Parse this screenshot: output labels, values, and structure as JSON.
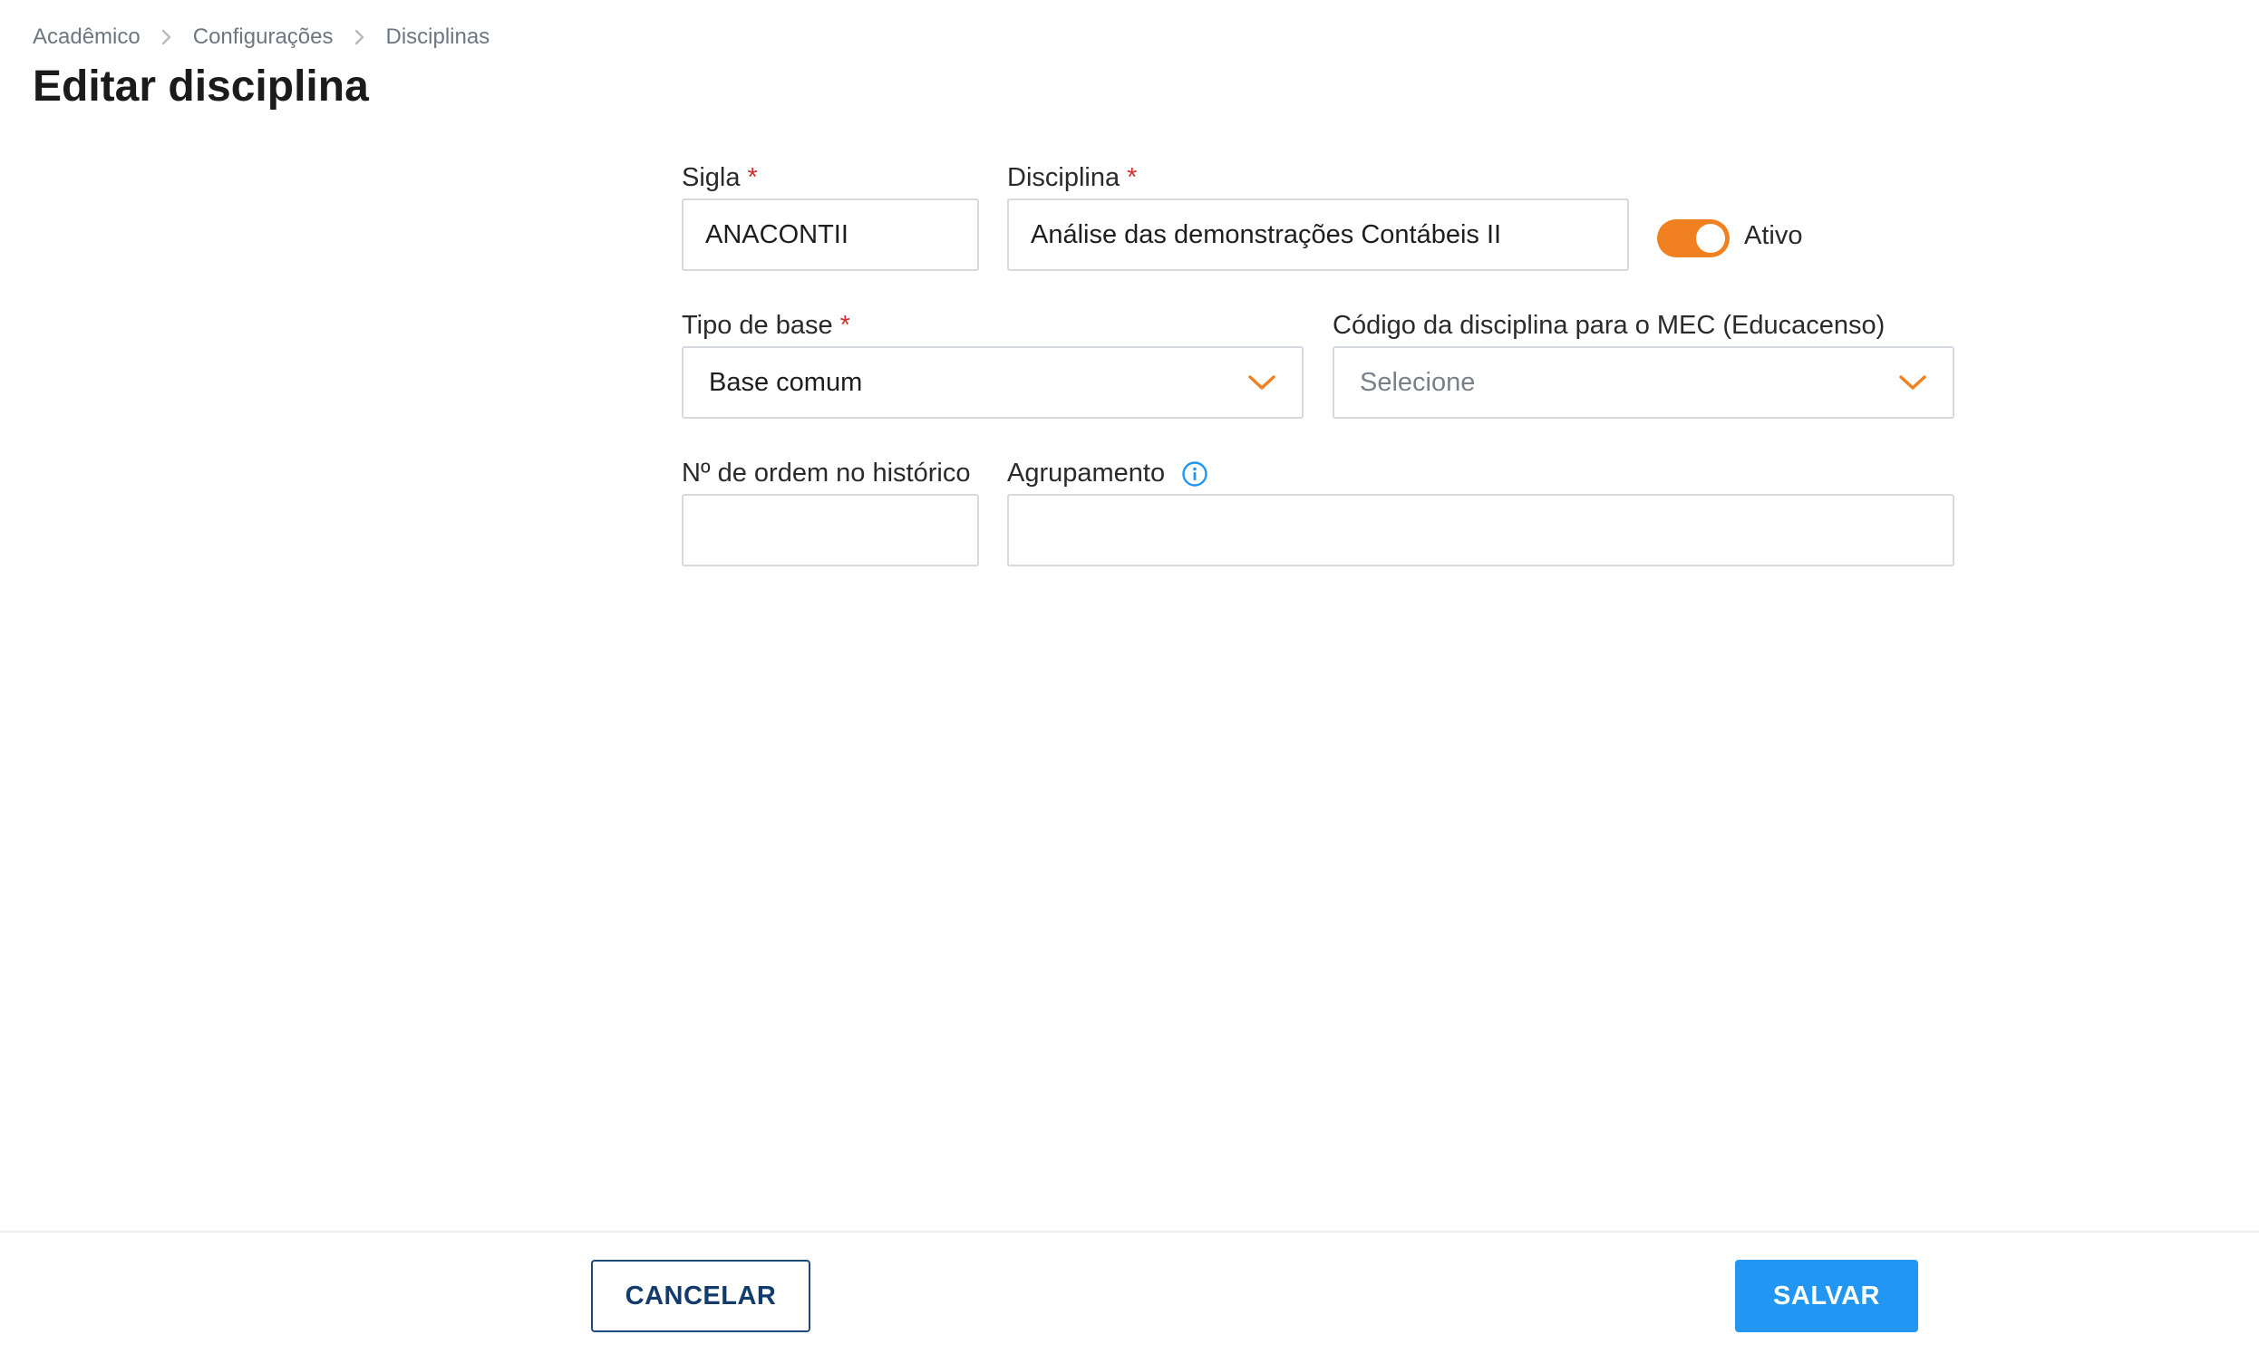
{
  "breadcrumb": {
    "items": [
      "Acadêmico",
      "Configurações",
      "Disciplinas"
    ]
  },
  "page": {
    "title": "Editar disciplina"
  },
  "form": {
    "sigla": {
      "label": "Sigla",
      "required_mark": "*",
      "value": "ANACONTII"
    },
    "disciplina": {
      "label": "Disciplina",
      "required_mark": "*",
      "value": "Análise das demonstrações Contábeis II"
    },
    "ativo": {
      "label": "Ativo",
      "checked": true
    },
    "tipo_base": {
      "label": "Tipo de base",
      "required_mark": "*",
      "value": "Base comum"
    },
    "codigo_mec": {
      "label": "Código da disciplina para o MEC (Educacenso)",
      "placeholder": "Selecione"
    },
    "ordem_historico": {
      "label": "Nº de ordem no histórico",
      "value": ""
    },
    "agrupamento": {
      "label": "Agrupamento",
      "value": ""
    }
  },
  "footer": {
    "cancel_label": "CANCELAR",
    "save_label": "SALVAR"
  },
  "colors": {
    "accent_orange": "#f08020",
    "primary_blue": "#2196f3",
    "cancel_border": "#1a4a7a",
    "required_red": "#d32f2f",
    "info_blue": "#2196f3"
  },
  "icons": {
    "breadcrumb_separator": "chevron-right-icon",
    "select_arrow": "chevron-down-icon",
    "info": "info-icon"
  }
}
